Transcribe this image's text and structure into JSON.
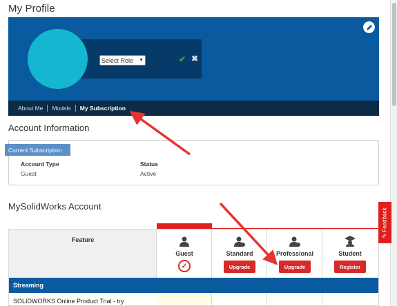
{
  "page": {
    "title": "My Profile"
  },
  "profile": {
    "role_select": {
      "selected": "Select Role"
    },
    "tabs": [
      {
        "label": "About Me"
      },
      {
        "label": "Models"
      },
      {
        "label": "My Subscription"
      }
    ],
    "icons": [
      "pencil-icon",
      "checkmark-icon",
      "close-icon"
    ]
  },
  "account_info": {
    "title": "Account Information",
    "tag": "Current Subscription",
    "headers": {
      "account_type": "Account Type",
      "status": "Status"
    },
    "values": {
      "account_type": "Guest",
      "status": "Active"
    }
  },
  "mysolidworks": {
    "title": "MySolidWorks Account",
    "feature_header": "Feature",
    "plans": [
      {
        "name": "Guest",
        "action": "",
        "current": true
      },
      {
        "name": "Standard",
        "action": "Upgrade"
      },
      {
        "name": "Professional",
        "action": "Upgrade"
      },
      {
        "name": "Student",
        "action": "Register"
      }
    ],
    "section": "Streaming",
    "row": "SOLIDWORKS Online Product Trial - try"
  },
  "feedback": {
    "label": "Feedback"
  },
  "colors": {
    "banner": "#0a5aa0",
    "accent": "#d62a2a",
    "avatar": "#14b7cf",
    "nav": "#0b2b47"
  }
}
